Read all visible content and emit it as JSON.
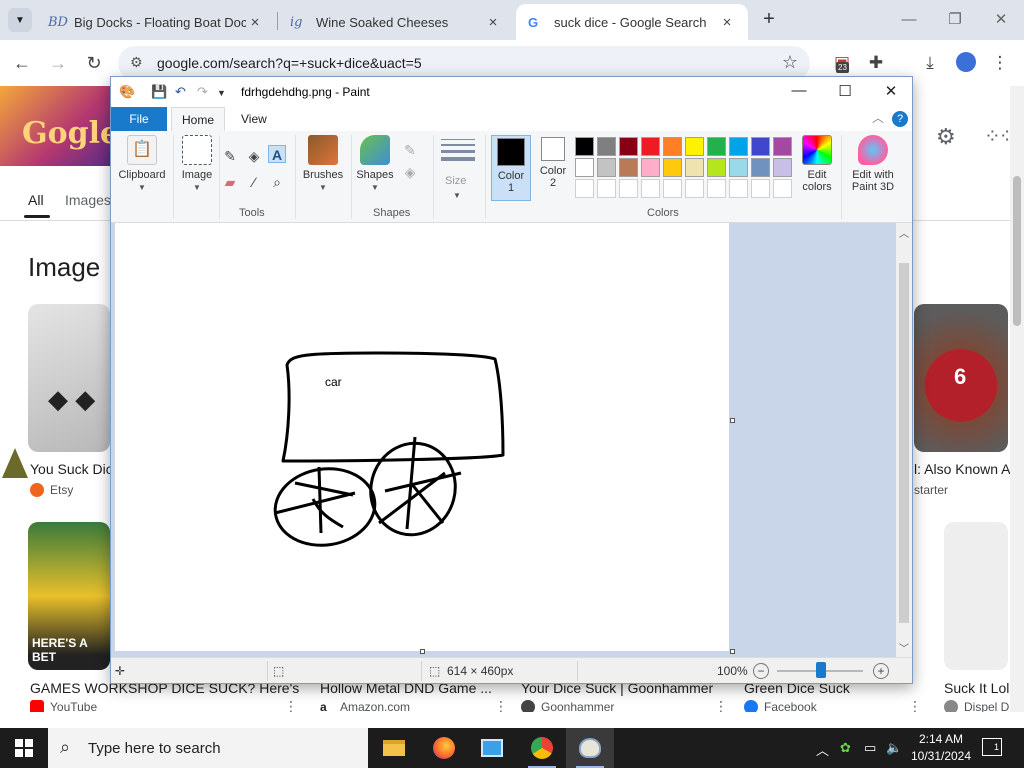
{
  "browser": {
    "tabs": [
      {
        "favicon": "BD",
        "title": "Big Docks - Floating Boat Dock",
        "active": false
      },
      {
        "favicon": "ig",
        "title": "Wine Soaked Cheeses",
        "active": false
      },
      {
        "favicon": "G",
        "title": "suck dice - Google Search",
        "active": true
      }
    ],
    "url": "google.com/search?q=+suck+dice&uact=5",
    "extension_badge": "23"
  },
  "google": {
    "tabs": [
      "All",
      "Images"
    ],
    "section_title": "Image",
    "results": [
      {
        "title": "You Suck Dic",
        "source": "Etsy",
        "source_color": "#f1641e"
      },
      {
        "title": "l: Also Known A",
        "source": "starter",
        "source_color": ""
      },
      {
        "title": "GAMES WORKSHOP DICE SUCK? Here's ...",
        "source": "YouTube",
        "source_color": "#ff0000"
      },
      {
        "title": "Hollow Metal DND Game ...",
        "source": "Amazon.com",
        "source_color": "#222222"
      },
      {
        "title": "Your Dice Suck | Goonhammer",
        "source": "Goonhammer",
        "source_color": "#444444"
      },
      {
        "title": "Green Dice Suck",
        "source": "Facebook",
        "source_color": "#1877f2"
      },
      {
        "title": "Suck It Lol",
        "source": "Dispel D",
        "source_color": "#888888"
      }
    ],
    "thumb_caption": "HERE'S A BET"
  },
  "paint": {
    "title": "fdrhgdehdhg.png - Paint",
    "ribbon_tabs": {
      "file": "File",
      "home": "Home",
      "view": "View"
    },
    "buttons": {
      "clipboard": "Clipboard",
      "image": "Image",
      "brushes": "Brushes",
      "shapes": "Shapes",
      "size": "Size",
      "color1": "Color\n1",
      "color2": "Color\n2",
      "edit_colors": "Edit\ncolors",
      "edit_paint3d": "Edit with\nPaint 3D"
    },
    "groups": {
      "tools": "Tools",
      "shapes": "Shapes",
      "colors": "Colors"
    },
    "colors": {
      "color1": "#000000",
      "color2": "#ffffff",
      "palette_row1": [
        "#000000",
        "#7f7f7f",
        "#880015",
        "#ed1c24",
        "#ff7f27",
        "#fff200",
        "#22b14c",
        "#00a2e8",
        "#3f48cc",
        "#a349a4"
      ],
      "palette_row2": [
        "#ffffff",
        "#c3c3c3",
        "#b97a57",
        "#ffaec9",
        "#ffc90e",
        "#efe4b0",
        "#b5e61d",
        "#99d9ea",
        "#7092be",
        "#c8bfe7"
      ],
      "palette_row3": [
        "#ffffff",
        "#ffffff",
        "#ffffff",
        "#ffffff",
        "#ffffff",
        "#ffffff",
        "#ffffff",
        "#ffffff",
        "#ffffff",
        "#ffffff"
      ]
    },
    "canvas_text": "car",
    "status": {
      "dimensions": "614 × 460px",
      "zoom": "100%"
    }
  },
  "taskbar": {
    "search_placeholder": "Type here to search",
    "time": "2:14 AM",
    "date": "10/31/2024",
    "notification_count": "1"
  }
}
